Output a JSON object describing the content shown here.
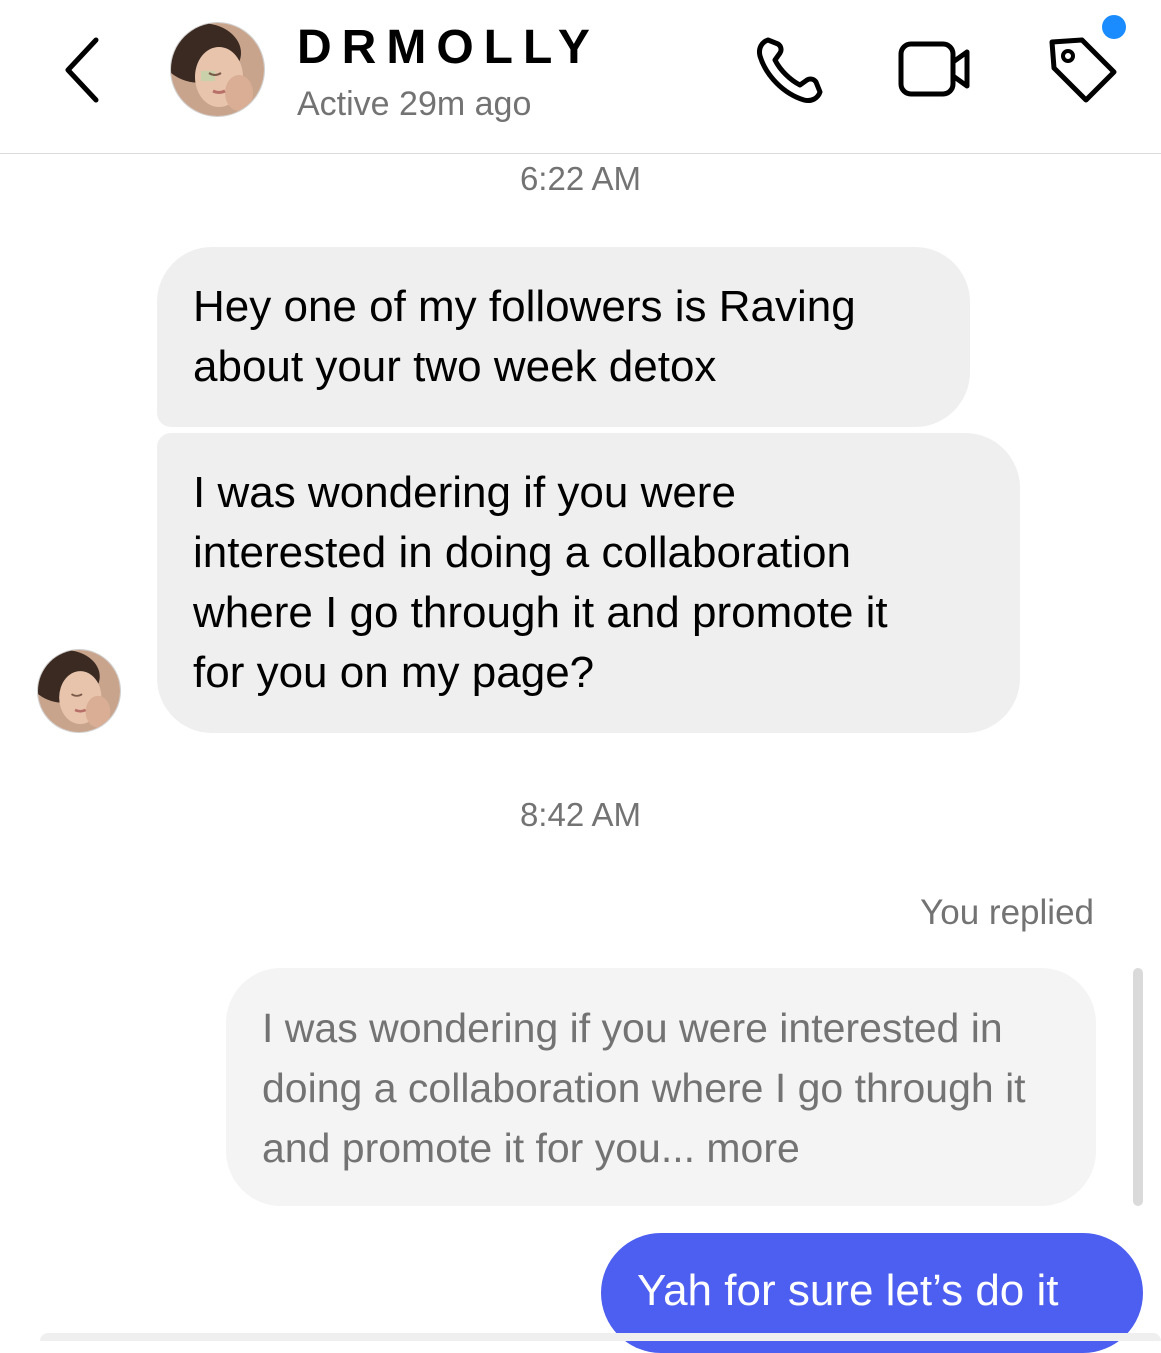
{
  "header": {
    "username": "DRMOLLY",
    "status": "Active 29m ago",
    "back_icon": "chevron-left-icon",
    "call_icon": "phone-icon",
    "video_icon": "video-camera-icon",
    "tag_icon": "tag-icon",
    "notification_color": "#1a8cff"
  },
  "thread": {
    "timestamp_1": "6:22 AM",
    "message_1": "Hey one of my followers is Raving\nabout your two week detox",
    "message_2": "I was wondering if you were\ninterested in doing a collaboration\nwhere I go through it and promote it\nfor you on my page?",
    "timestamp_2": "8:42 AM",
    "you_replied_label": "You replied",
    "quoted_text": "I was wondering if you were interested in doing a collaboration where I go through it and promote it for you... more",
    "reply": "Yah for sure let’s do it"
  },
  "colors": {
    "incoming_bubble": "#efefef",
    "outgoing_bubble": "#4d5ff0",
    "secondary_text": "#737373"
  }
}
